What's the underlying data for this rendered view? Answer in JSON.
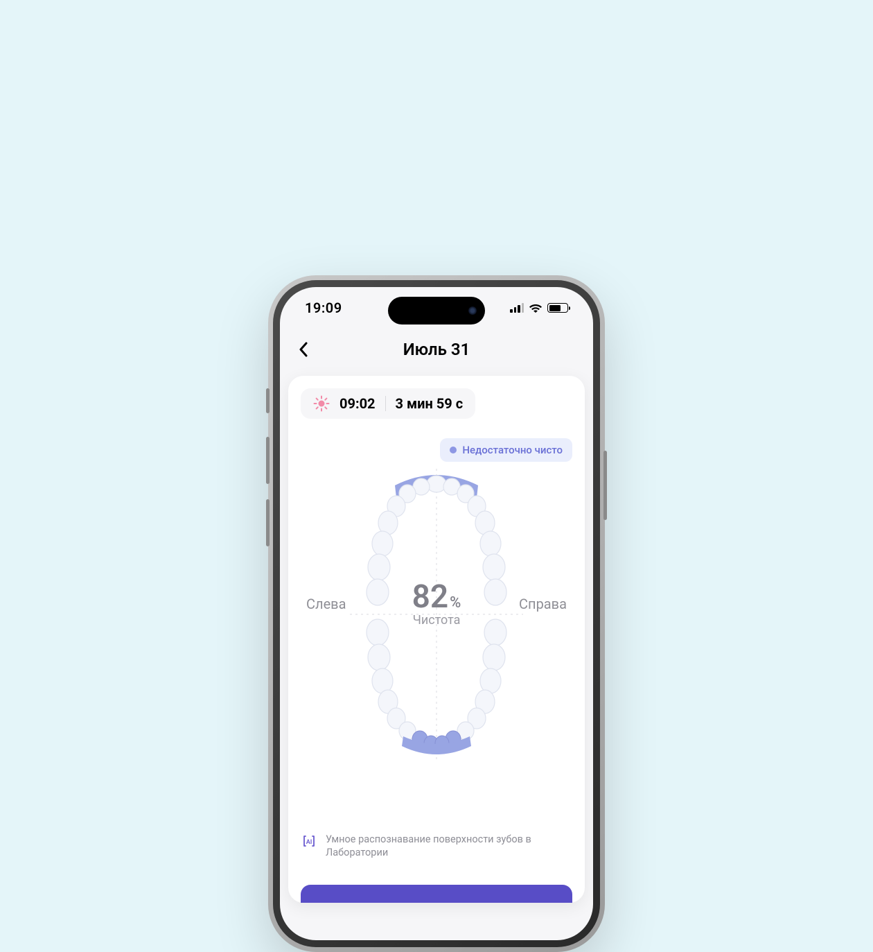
{
  "status_bar": {
    "time": "19:09"
  },
  "header": {
    "title": "Июль 31"
  },
  "session": {
    "time": "09:02",
    "duration": "3 мин 59 с"
  },
  "chip": {
    "label": "Недостаточно чисто"
  },
  "score": {
    "value": "82",
    "percent": "%",
    "label": "Чистота",
    "left_label": "Слева",
    "right_label": "Справа"
  },
  "ai": {
    "text": "Умное распознавание поверхности зубов в Лаборатории"
  },
  "colors": {
    "highlight": "#98a5e3",
    "tooth": "#f4f6fb",
    "tooth_stroke": "#dfe3ee"
  }
}
